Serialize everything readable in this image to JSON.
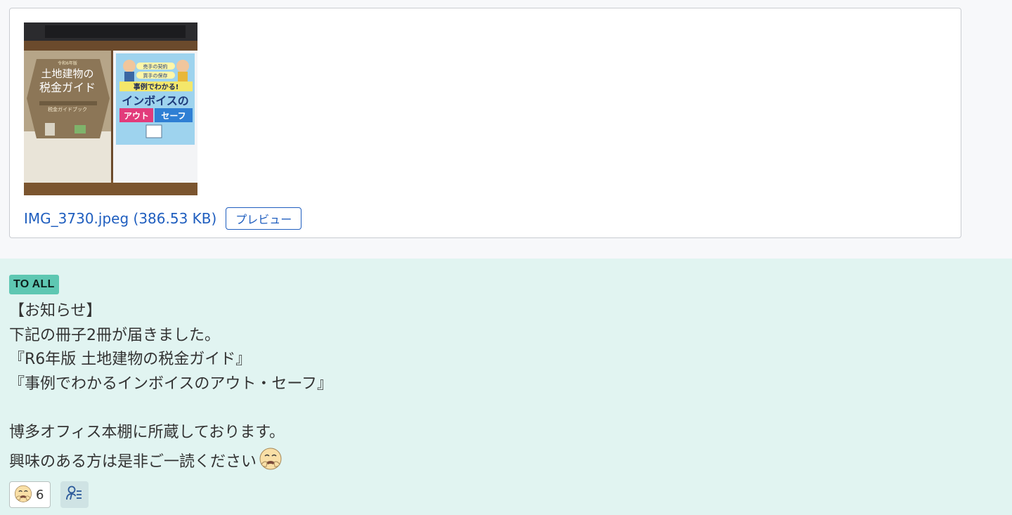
{
  "attachment": {
    "thumbnail": {
      "book_left": {
        "edition": "令和6年版",
        "title_line1": "土地建物の",
        "title_line2": "税金ガイド",
        "subtitle": "税金ガイドブック"
      },
      "book_right": {
        "bubble1": "売手の契約",
        "bubble2": "買手の保存",
        "banner": "事例でわかる!",
        "title": "インボイスの",
        "out": "アウト",
        "safe": "セーフ"
      }
    },
    "file_label": "IMG_3730.jpeg (386.53 KB)",
    "preview_label": "プレビュー"
  },
  "message": {
    "to_badge": "TO ALL",
    "lines": [
      "【お知らせ】",
      "下記の冊子2冊が届きました。",
      "『R6年版 土地建物の税金ガイド』",
      "『事例でわかるインボイスのアウト・セーフ』",
      "",
      "博多オフィス本棚に所蔵しております。",
      "興味のある方は是非ご一読ください"
    ],
    "inline_emoji": "thanks-face-icon"
  },
  "reactions": [
    {
      "icon": "thanks-face-icon",
      "count": "6"
    }
  ],
  "readers_icon": "readers-list-icon",
  "colors": {
    "link": "#1f5ebf",
    "message_bg": "#e1f4f1",
    "badge_bg": "#5ec7b2"
  }
}
